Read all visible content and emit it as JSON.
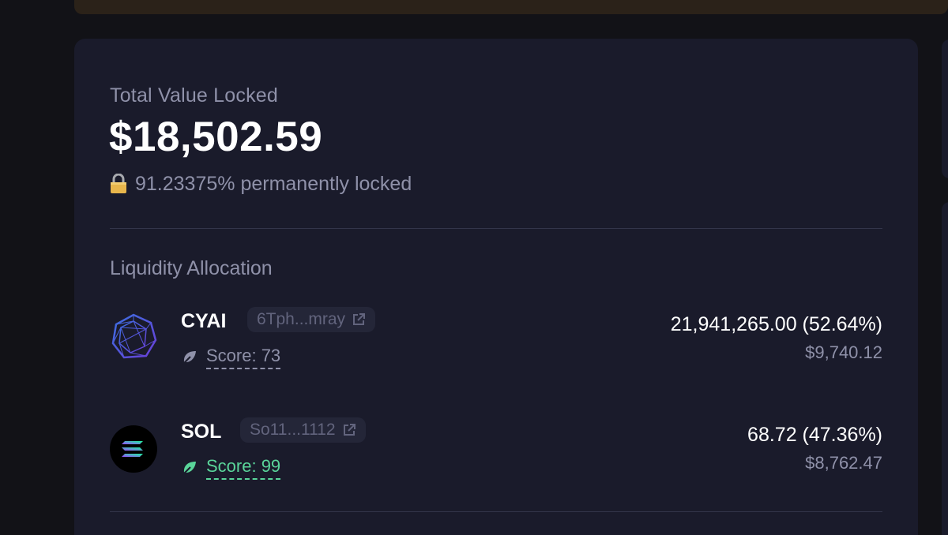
{
  "summary": {
    "tvl_label": "Total Value Locked",
    "tvl_value": "$18,502.59",
    "locked_text": "91.23375% permanently locked"
  },
  "allocation": {
    "title": "Liquidity Allocation",
    "tokens": [
      {
        "symbol": "CYAI",
        "address": "6Tph...mray",
        "score": "Score: 73",
        "amount": "21,941,265.00 (52.64%)",
        "usd": "$9,740.12"
      },
      {
        "symbol": "SOL",
        "address": "So11...1112",
        "score": "Score: 99",
        "amount": "68.72 (47.36%)",
        "usd": "$8,762.47"
      }
    ]
  },
  "colors": {
    "background": "#121217",
    "card": "#1a1b2b",
    "muted_text": "#8f91a9",
    "score_good": "#5ad59a",
    "banner": "#2b2219"
  },
  "icons": [
    "lock-icon",
    "cyai-logo",
    "sol-logo",
    "external-link-icon",
    "leaf-icon"
  ]
}
